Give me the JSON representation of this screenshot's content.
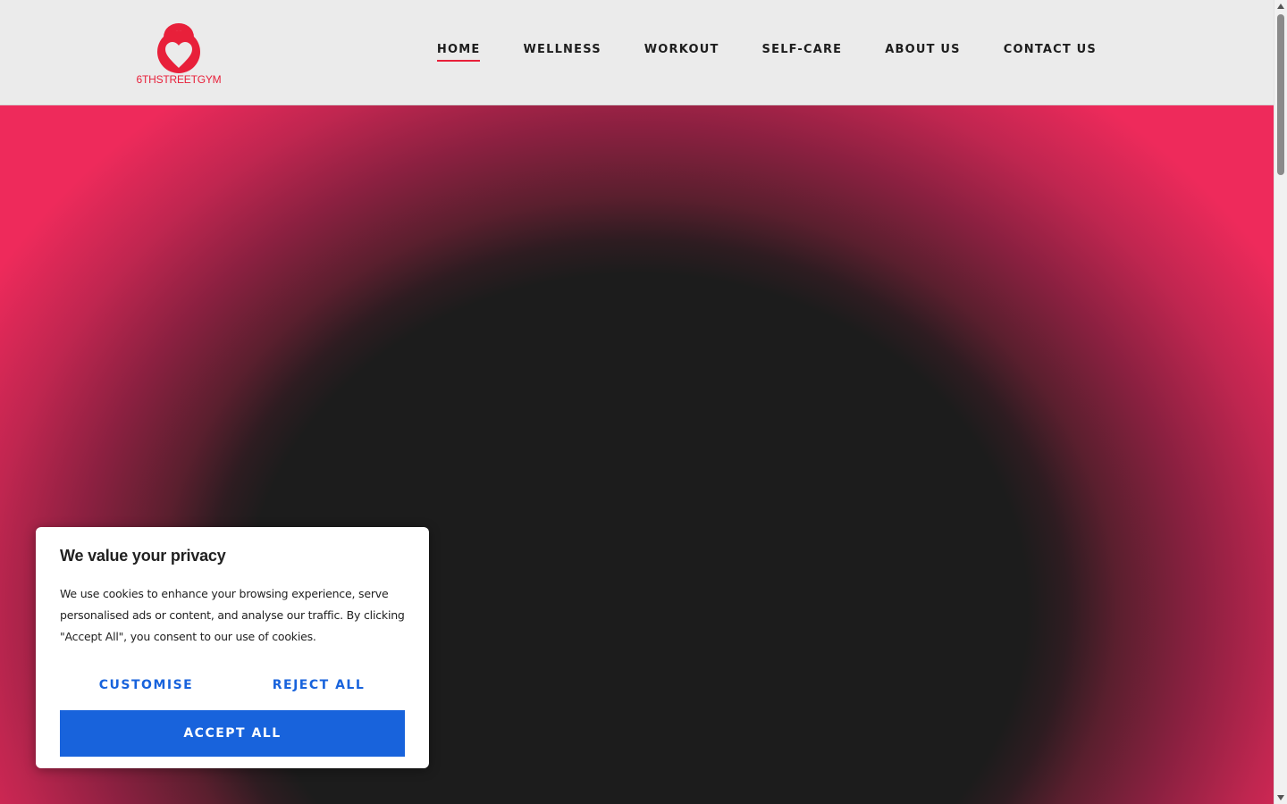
{
  "header": {
    "logo_text": "6THSTREETGYM",
    "nav": [
      {
        "label": "HOME",
        "active": true
      },
      {
        "label": "WELLNESS",
        "active": false
      },
      {
        "label": "WORKOUT",
        "active": false
      },
      {
        "label": "SELF-CARE",
        "active": false
      },
      {
        "label": "ABOUT US",
        "active": false
      },
      {
        "label": "CONTACT US",
        "active": false
      }
    ]
  },
  "cookie_banner": {
    "title": "We value your privacy",
    "text": "We use cookies to enhance your browsing experience, serve personalised ads or content, and analyse our traffic. By clicking \"Accept All\", you consent to our use of cookies.",
    "customise_label": "CUSTOMISE",
    "reject_label": "REJECT ALL",
    "accept_label": "ACCEPT ALL"
  },
  "colors": {
    "brand_red": "#e8203a",
    "button_blue": "#1863dc",
    "hero_pink": "#ee2a5b",
    "hero_dark": "#1c1c1c"
  },
  "icons": {
    "logo": "kettlebell-heart-icon"
  }
}
